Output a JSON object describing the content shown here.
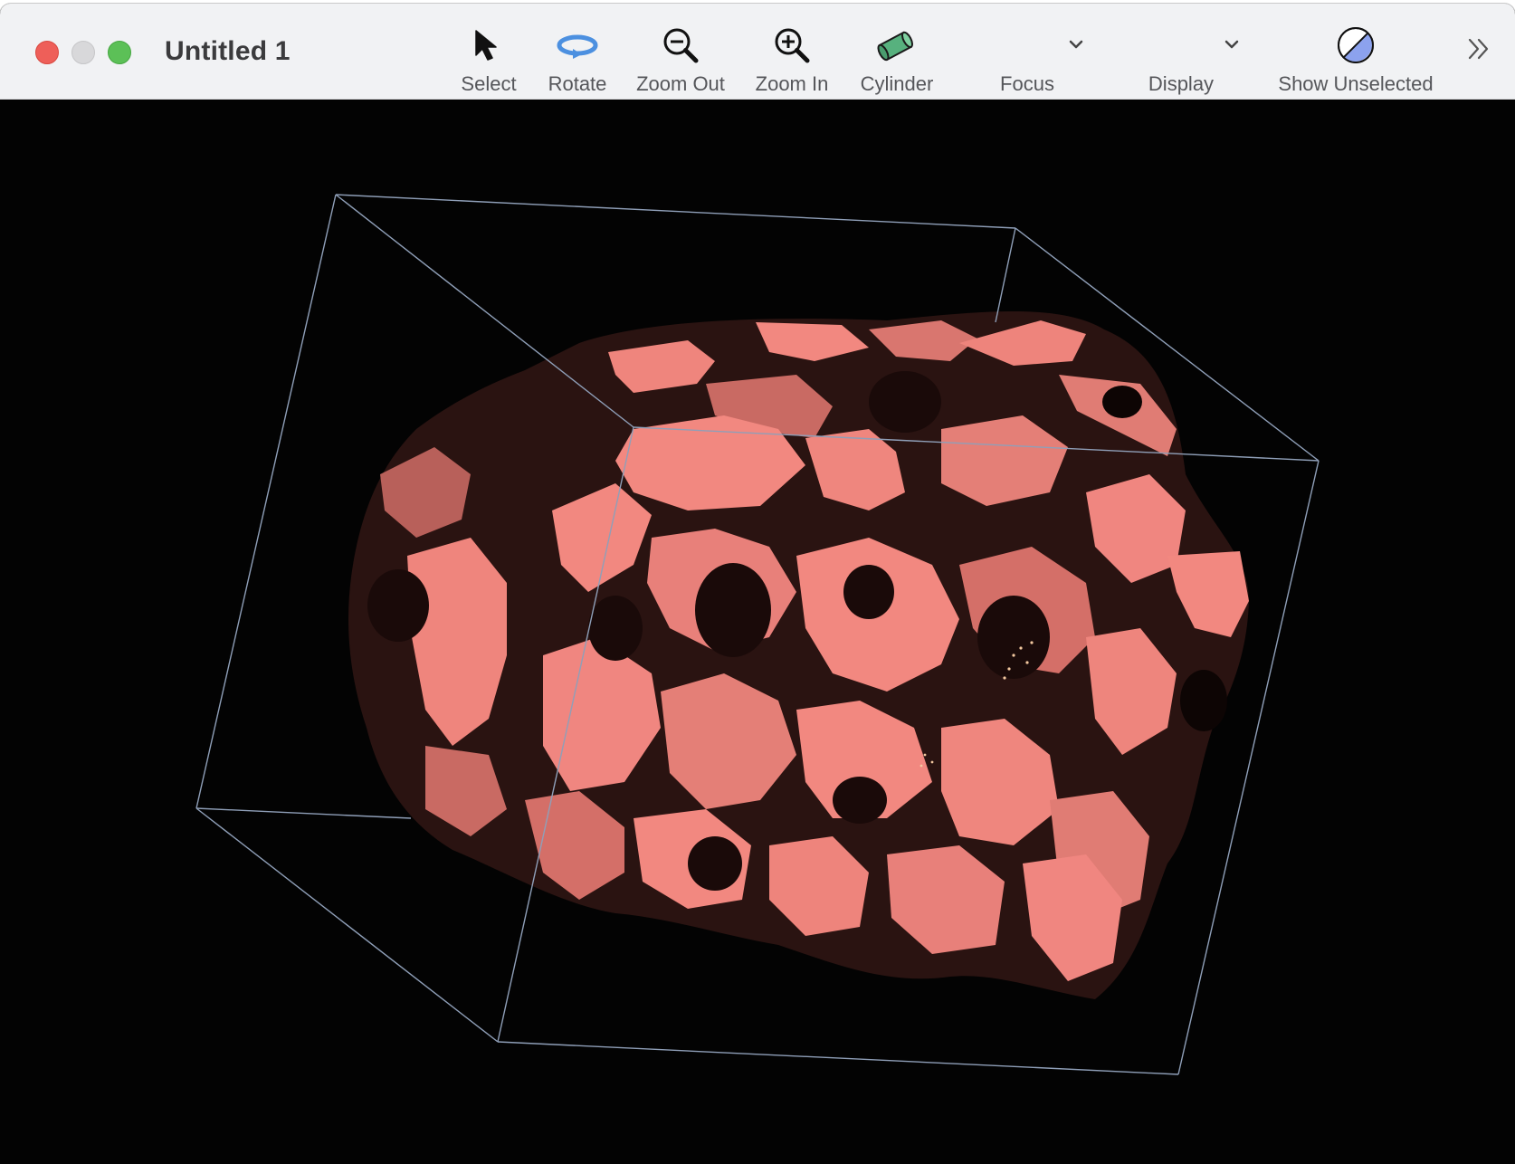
{
  "window": {
    "title": "Untitled 1"
  },
  "toolbar": {
    "select_label": "Select",
    "rotate_label": "Rotate",
    "zoom_out_label": "Zoom Out",
    "zoom_in_label": "Zoom In",
    "cylinder_label": "Cylinder",
    "focus_label": "Focus",
    "display_label": "Display",
    "show_unselected_label": "Show Unselected"
  },
  "icons": {
    "select": "arrow-cursor-icon",
    "rotate": "rotate-icon",
    "zoom_out": "zoom-out-icon",
    "zoom_in": "zoom-in-icon",
    "cylinder": "cylinder-icon",
    "focus": "chevron-down-icon",
    "display": "chevron-down-icon",
    "show_unselected": "half-circle-icon",
    "overflow": "double-chevron-right-icon"
  },
  "colors": {
    "surface_light": "#f28880",
    "surface_mid": "#c56a64",
    "surface_dark": "#3a1c1a",
    "bounding_box": "#8f9fb8",
    "background": "#030303",
    "cylinder_icon": "#57b17e",
    "rotate_icon": "#4c90e0",
    "show_unselected_icon": "#8ca2ee"
  }
}
